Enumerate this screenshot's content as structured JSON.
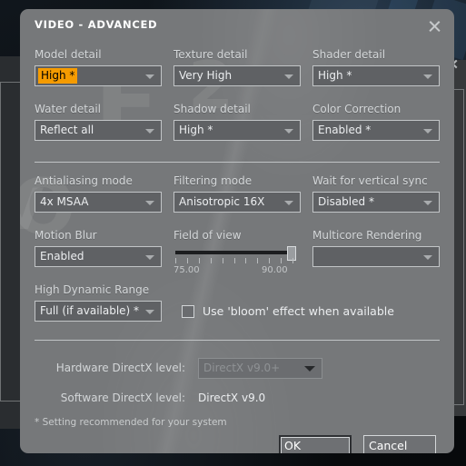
{
  "dialog": {
    "title": "VIDEO - ADVANCED",
    "close_icon": "close-icon"
  },
  "fields": {
    "model_detail": {
      "label": "Model detail",
      "value": "High *"
    },
    "texture_detail": {
      "label": "Texture detail",
      "value": "Very High"
    },
    "shader_detail": {
      "label": "Shader detail",
      "value": "High *"
    },
    "water_detail": {
      "label": "Water detail",
      "value": "Reflect all"
    },
    "shadow_detail": {
      "label": "Shadow detail",
      "value": "High *"
    },
    "color_correction": {
      "label": "Color Correction",
      "value": "Enabled *"
    },
    "antialiasing_mode": {
      "label": "Antialiasing mode",
      "value": "4x MSAA"
    },
    "filtering_mode": {
      "label": "Filtering mode",
      "value": "Anisotropic 16X"
    },
    "vertical_sync": {
      "label": "Wait for vertical sync",
      "value": "Disabled *"
    },
    "motion_blur": {
      "label": "Motion Blur",
      "value": "Enabled"
    },
    "multicore_rendering": {
      "label": "Multicore Rendering",
      "value": ""
    },
    "hdr": {
      "label": "High Dynamic Range",
      "value": "Full (if available) *"
    }
  },
  "field_of_view": {
    "label": "Field of view",
    "min_label": "75.00",
    "max_label": "90.00",
    "min": 75.0,
    "max": 90.0,
    "value": 90.0,
    "tick_count": 11
  },
  "bloom": {
    "label": "Use 'bloom' effect when available",
    "checked": false
  },
  "directx": {
    "hardware": {
      "label": "Hardware DirectX level:",
      "value": "DirectX v9.0+",
      "disabled": true
    },
    "software": {
      "label": "Software DirectX level:",
      "value": "DirectX v9.0"
    }
  },
  "footnote": "* Setting recommended for your system",
  "buttons": {
    "ok": "OK",
    "cancel": "Cancel"
  },
  "colors": {
    "dialog_bg": "#76787a",
    "combo_bg": "#5f6164",
    "combo_border": "#c2c5c7",
    "highlight": "#f59b00",
    "highlight_text": "#000000",
    "text": "#eceef0",
    "label_text": "#d3d6d8"
  },
  "watermarks": {
    "e": "E",
    "two": "2",
    "o": "O",
    "v": "V"
  }
}
